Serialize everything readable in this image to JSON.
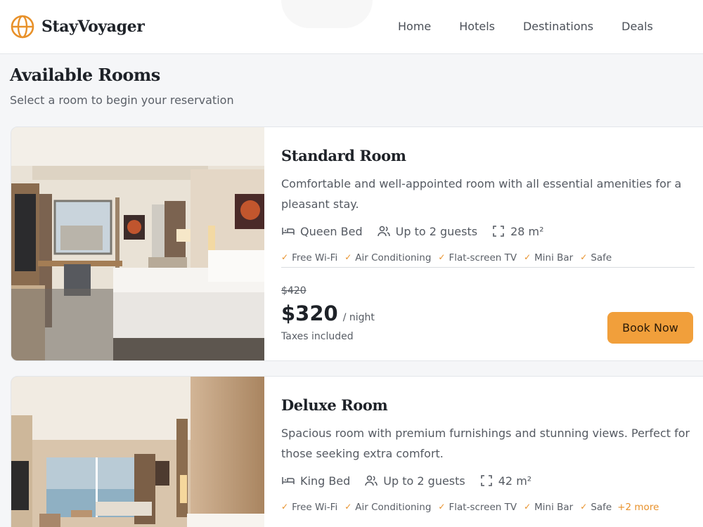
{
  "header": {
    "brand": "StayVoyager",
    "nav": [
      "Home",
      "Hotels",
      "Destinations",
      "Deals"
    ]
  },
  "page": {
    "title": "Available Rooms",
    "subtitle": "Select a room to begin your reservation"
  },
  "rooms": [
    {
      "name": "Standard Room",
      "description": "Comfortable and well-appointed room with all essential amenities for a pleasant stay.",
      "bed": "Queen Bed",
      "guests": "Up to 2 guests",
      "size": "28 m²",
      "amenities": [
        "Free Wi-Fi",
        "Air Conditioning",
        "Flat-screen TV",
        "Mini Bar",
        "Safe"
      ],
      "old_price": "$420",
      "price": "$320",
      "per": "/ night",
      "taxes": "Taxes included",
      "button": "Book Now"
    },
    {
      "name": "Deluxe Room",
      "description": "Spacious room with premium furnishings and stunning views. Perfect for those seeking extra comfort.",
      "bed": "King Bed",
      "guests": "Up to 2 guests",
      "size": "42 m²",
      "amenities": [
        "Free Wi-Fi",
        "Air Conditioning",
        "Flat-screen TV",
        "Mini Bar",
        "Safe"
      ],
      "more": "+2 more"
    }
  ],
  "colors": {
    "accent": "#f19f3b",
    "check": "#e8912a",
    "text_dark": "#1e2228",
    "background": "#f5f6f8"
  },
  "icons": [
    "globe-logo-icon",
    "bed-icon",
    "guests-icon",
    "area-icon",
    "check-icon"
  ]
}
